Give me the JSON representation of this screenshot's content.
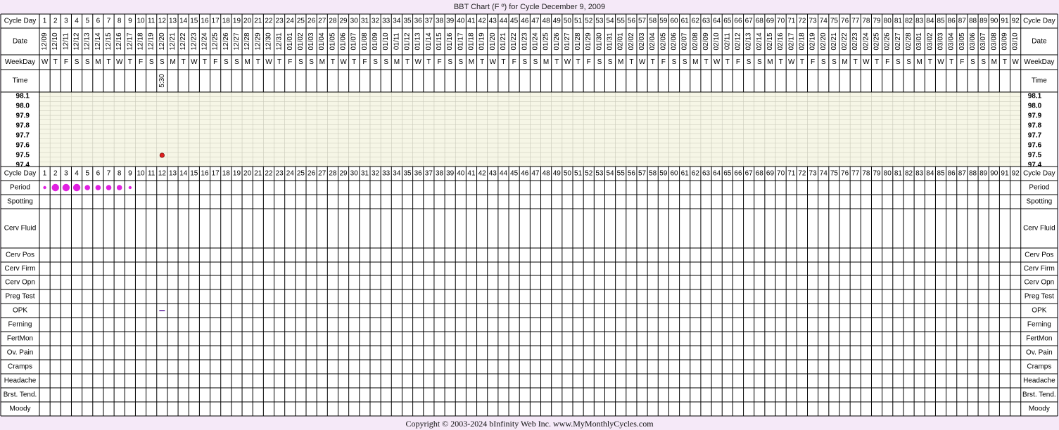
{
  "title": "BBT Chart (F º) for Cycle December 9, 2009",
  "copyright": "Copyright © 2003-2024 bInfinity Web Inc.     www.MyMonthlyCycles.com",
  "colors": {
    "background": "#f5e9f8",
    "temp_bg": "#f6f6e6",
    "grid_line": "#000000",
    "temp_grid": "#c8c8b8",
    "period_dot": "#e020e0",
    "temp_point": "#e02020",
    "opk_mark": "#8050b0"
  },
  "row_labels": {
    "cycle_day": "Cycle Day",
    "date": "Date",
    "weekday": "WeekDay",
    "time": "Time",
    "cycle_day_bottom": "Cycle Day",
    "observations": [
      "Period",
      "Spotting",
      "Cerv Fluid",
      "Cerv Pos",
      "Cerv Firm",
      "Cerv Opn",
      "Preg Test",
      "OPK",
      "Ferning",
      "FertMon",
      "Ov. Pain",
      "Cramps",
      "Headache",
      "Brst. Tend.",
      "Moody"
    ]
  },
  "chart_data": {
    "type": "scatter",
    "title": "BBT Chart (F º) for Cycle December 9, 2009",
    "cycle_days": [
      1,
      2,
      3,
      4,
      5,
      6,
      7,
      8,
      9,
      10,
      11,
      12,
      13,
      14,
      15,
      16,
      17,
      18,
      19,
      20,
      21,
      22,
      23,
      24,
      25,
      26,
      27,
      28,
      29,
      30,
      31,
      32,
      33,
      34,
      35,
      36,
      37,
      38,
      39,
      40,
      41,
      42,
      43,
      44,
      45,
      46,
      47,
      48,
      49,
      50,
      51,
      52,
      53,
      54,
      55,
      56,
      57,
      58,
      59,
      60,
      61,
      62,
      63,
      64,
      65,
      66,
      67,
      68,
      69,
      70,
      71,
      72,
      73,
      74,
      75,
      76,
      77,
      78,
      79,
      80,
      81,
      82,
      83,
      84,
      85,
      86,
      87,
      88,
      89,
      90,
      91,
      92
    ],
    "dates": [
      "12/09",
      "12/10",
      "12/11",
      "12/12",
      "12/13",
      "12/14",
      "12/15",
      "12/16",
      "12/17",
      "12/18",
      "12/19",
      "12/20",
      "12/21",
      "12/22",
      "12/23",
      "12/24",
      "12/25",
      "12/26",
      "12/27",
      "12/28",
      "12/29",
      "12/30",
      "12/31",
      "01/01",
      "01/02",
      "01/03",
      "01/04",
      "01/05",
      "01/06",
      "01/07",
      "01/08",
      "01/09",
      "01/10",
      "01/11",
      "01/12",
      "01/13",
      "01/14",
      "01/15",
      "01/16",
      "01/17",
      "01/18",
      "01/19",
      "01/20",
      "01/21",
      "01/22",
      "01/23",
      "01/24",
      "01/25",
      "01/26",
      "01/27",
      "01/28",
      "01/29",
      "01/30",
      "01/31",
      "02/01",
      "02/02",
      "02/03",
      "02/04",
      "02/05",
      "02/06",
      "02/07",
      "02/08",
      "02/09",
      "02/10",
      "02/11",
      "02/12",
      "02/13",
      "02/14",
      "02/15",
      "02/16",
      "02/17",
      "02/18",
      "02/19",
      "02/20",
      "02/21",
      "02/22",
      "02/23",
      "02/24",
      "02/25",
      "02/26",
      "02/27",
      "02/28",
      "03/01",
      "03/02",
      "03/03",
      "03/04",
      "03/05",
      "03/06",
      "03/07",
      "03/08",
      "03/09",
      "03/10"
    ],
    "weekdays": [
      "W",
      "T",
      "F",
      "S",
      "S",
      "M",
      "T",
      "W",
      "T",
      "F",
      "S",
      "S",
      "M",
      "T",
      "W",
      "T",
      "F",
      "S",
      "S",
      "M",
      "T",
      "W",
      "T",
      "F",
      "S",
      "S",
      "M",
      "T",
      "W",
      "T",
      "F",
      "S",
      "S",
      "M",
      "T",
      "W",
      "T",
      "F",
      "S",
      "S",
      "M",
      "T",
      "W",
      "T",
      "F",
      "S",
      "S",
      "M",
      "T",
      "W",
      "T",
      "F",
      "S",
      "S",
      "M",
      "T",
      "W",
      "T",
      "F",
      "S",
      "S",
      "M",
      "T",
      "W",
      "T",
      "F",
      "S",
      "S",
      "M",
      "T",
      "W",
      "T",
      "F",
      "S",
      "S",
      "M",
      "T",
      "W",
      "T",
      "F",
      "S",
      "S",
      "M",
      "T",
      "W",
      "T",
      "F",
      "S",
      "S",
      "M",
      "T",
      "W"
    ],
    "temp_axis": [
      "98.1",
      "98.0",
      "97.9",
      "97.8",
      "97.7",
      "97.6",
      "97.5",
      "97.4"
    ],
    "ylim": [
      97.4,
      98.1
    ],
    "temperatures": [
      {
        "day": 12,
        "temp": 97.5,
        "time": "5:30"
      }
    ],
    "period": [
      {
        "day": 1,
        "level": "light"
      },
      {
        "day": 2,
        "level": "heavy"
      },
      {
        "day": 3,
        "level": "heavy"
      },
      {
        "day": 4,
        "level": "heavy"
      },
      {
        "day": 5,
        "level": "medium"
      },
      {
        "day": 6,
        "level": "medium"
      },
      {
        "day": 7,
        "level": "medium"
      },
      {
        "day": 8,
        "level": "medium"
      },
      {
        "day": 9,
        "level": "light"
      }
    ],
    "opk": [
      {
        "day": 12,
        "result": "negative"
      }
    ]
  }
}
